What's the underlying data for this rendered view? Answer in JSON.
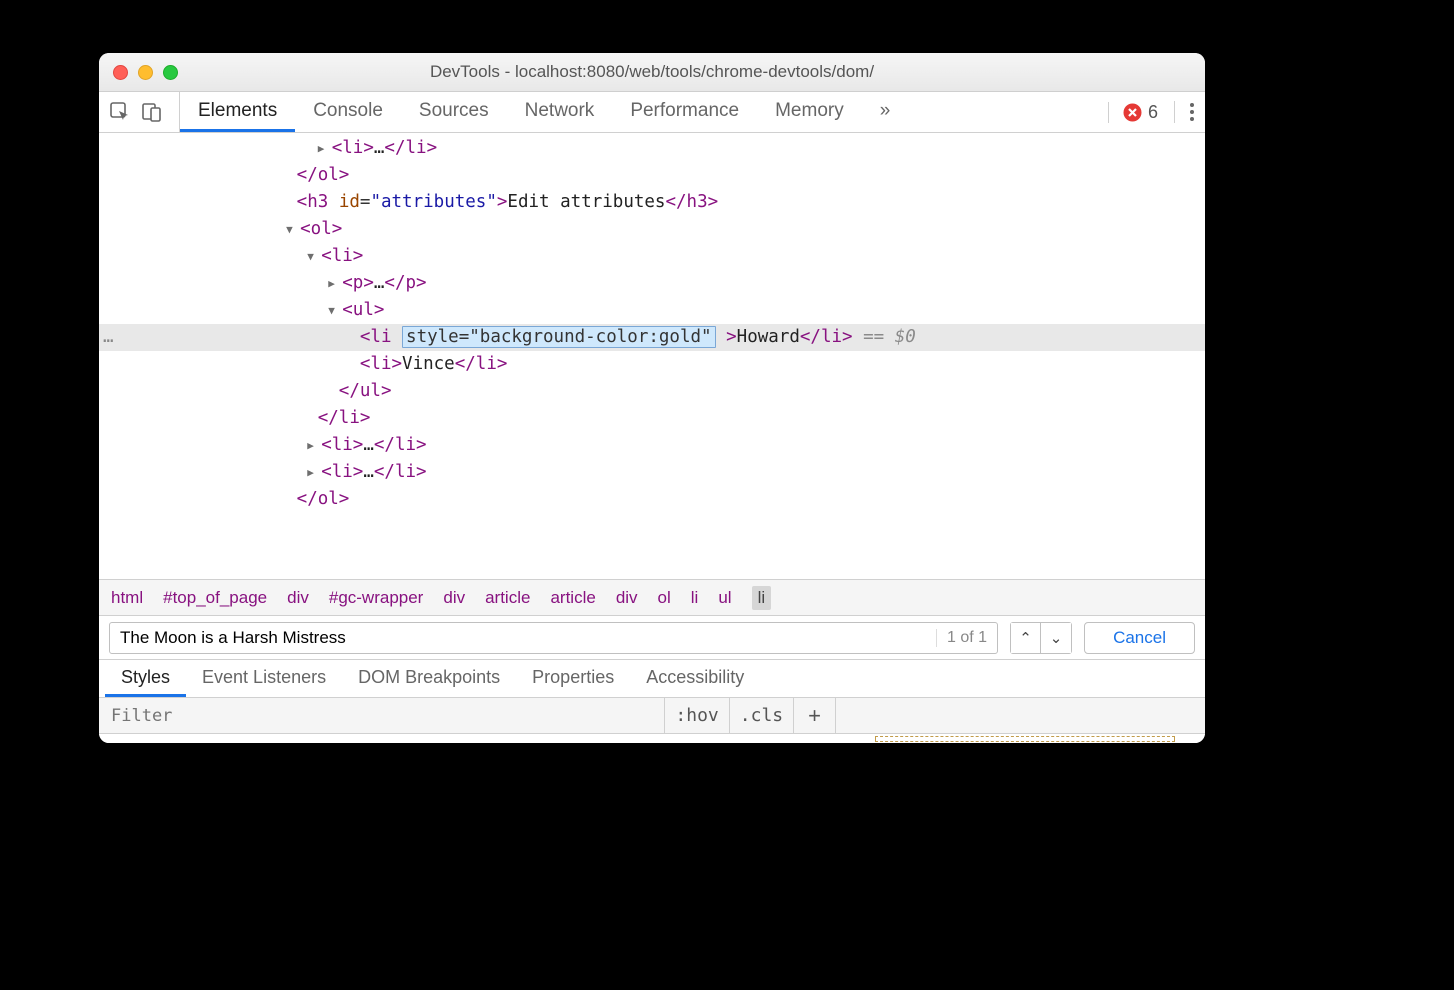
{
  "window": {
    "title": "DevTools - localhost:8080/web/tools/chrome-devtools/dom/"
  },
  "main_tabs": [
    "Elements",
    "Console",
    "Sources",
    "Network",
    "Performance",
    "Memory"
  ],
  "main_active_tab": "Elements",
  "overflow_glyph": "»",
  "error_count": "6",
  "dom": {
    "cutoff_open": "<li>",
    "cutoff_ell": "…",
    "cutoff_close": "</li>",
    "close_ol": "</ol>",
    "h3_open_tag": "<h3",
    "h3_attr_name": "id",
    "h3_attr_eq": "=",
    "h3_attr_val": "\"attributes\"",
    "h3_open_close": ">",
    "h3_text": "Edit attributes",
    "h3_close": "</h3>",
    "ol_open": "<ol>",
    "li_open": "<li>",
    "p_open": "<p>",
    "p_ell": "…",
    "p_close": "</p>",
    "ul_open": "<ul>",
    "li_self_open": "<li",
    "attr_edit": "style=\"background-color:gold\"",
    "li_self_open_close": ">",
    "howard": "Howard",
    "li_close": "</li>",
    "sel_marker": "== $0",
    "li_vince_open": "<li>",
    "vince": "Vince",
    "li_vince_close": "</li>",
    "ul_close": "</ul>",
    "li_outer_close": "</li>",
    "li_ell_open": "<li>",
    "li_ell_body": "…",
    "li_ell_close": "</li>",
    "ol_close_b": "</ol>",
    "gutter_dots": "…"
  },
  "breadcrumbs": [
    "html",
    "#top_of_page",
    "div",
    "#gc-wrapper",
    "div",
    "article",
    "article",
    "div",
    "ol",
    "li",
    "ul",
    "li"
  ],
  "search": {
    "value": "The Moon is a Harsh Mistress",
    "match_text": "1 of 1",
    "cancel": "Cancel"
  },
  "sub_tabs": [
    "Styles",
    "Event Listeners",
    "DOM Breakpoints",
    "Properties",
    "Accessibility"
  ],
  "sub_active": "Styles",
  "styles_toolbar": {
    "filter_placeholder": "Filter",
    "hov": ":hov",
    "cls": ".cls",
    "plus": "+"
  }
}
